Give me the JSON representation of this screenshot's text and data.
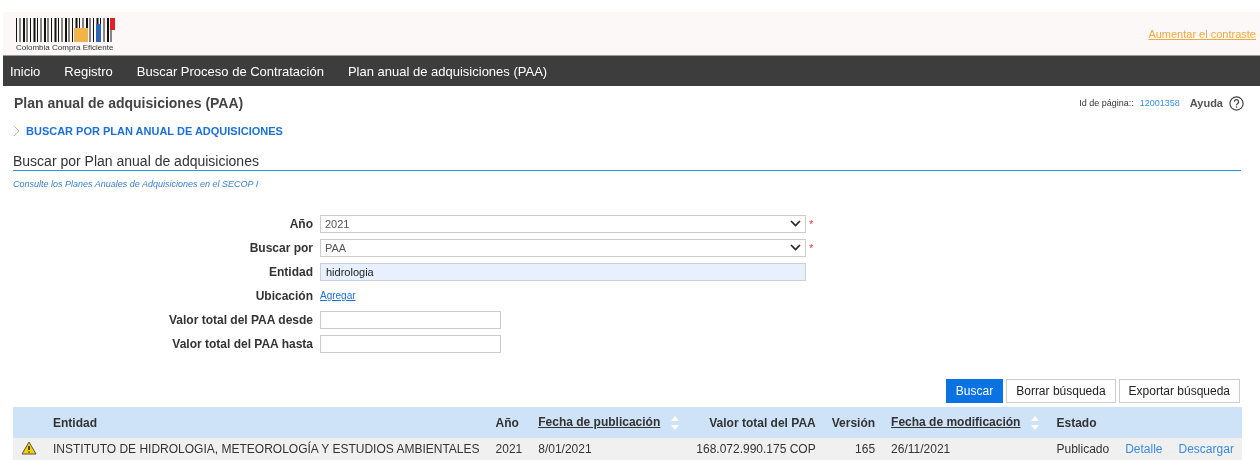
{
  "header": {
    "logo_text": "Colombia Compra Eficiente",
    "contrast_link": "Aumentar el contraste"
  },
  "nav": [
    {
      "label": "Inicio"
    },
    {
      "label": "Registro"
    },
    {
      "label": "Buscar Proceso de Contratación"
    },
    {
      "label": "Plan anual de adquisiciones (PAA)"
    }
  ],
  "page": {
    "title": "Plan anual de adquisiciones (PAA)",
    "page_id_label": "Id de página::",
    "page_id": "12001358",
    "help": "Ayuda"
  },
  "breadcrumb": "BUSCAR POR PLAN ANUAL DE ADQUISICIONES",
  "section": {
    "heading": "Buscar por Plan anual de adquisiciones",
    "hint": "Consulte los Planes Anuales de Adquisiciones en el SECOP I"
  },
  "form": [
    {
      "kind": "select",
      "label": "Año",
      "value": "2021",
      "required_mark": "*"
    },
    {
      "kind": "select",
      "label": "Buscar por",
      "value": "PAA",
      "required_mark": "*"
    },
    {
      "kind": "text",
      "label": "Entidad",
      "value": "hidrologia",
      "filled": true
    },
    {
      "kind": "link",
      "label": "Ubicación",
      "link": "Agregar"
    },
    {
      "kind": "short",
      "label": "Valor total del PAA desde"
    },
    {
      "kind": "short",
      "label": "Valor total del PAA hasta"
    }
  ],
  "buttons": [
    {
      "label": "Buscar",
      "primary": true
    },
    {
      "label": "Borrar búsqueda",
      "primary": false
    },
    {
      "label": "Exportar búsqueda",
      "primary": false
    }
  ],
  "table": {
    "columns": [
      {
        "label": "Entidad",
        "sortable": false
      },
      {
        "label": "Año",
        "sortable": false
      },
      {
        "label": "Fecha de publicación",
        "sortable": true
      },
      {
        "label": "Valor total del PAA",
        "sortable": false
      },
      {
        "label": "Versión",
        "sortable": false
      },
      {
        "label": "Fecha de modificación",
        "sortable": true
      },
      {
        "label": "Estado",
        "sortable": false
      }
    ],
    "rows": [
      {
        "warning": true,
        "cells": [
          "INSTITUTO DE HIDROLOGIA, METEOROLOGÍA Y ESTUDIOS AMBIENTALES",
          "2021",
          "8/01/2021",
          "168.072.990.175 COP",
          "165",
          "26/11/2021",
          "Publicado"
        ],
        "actions": [
          "Detalle",
          "Descargar"
        ]
      }
    ]
  }
}
